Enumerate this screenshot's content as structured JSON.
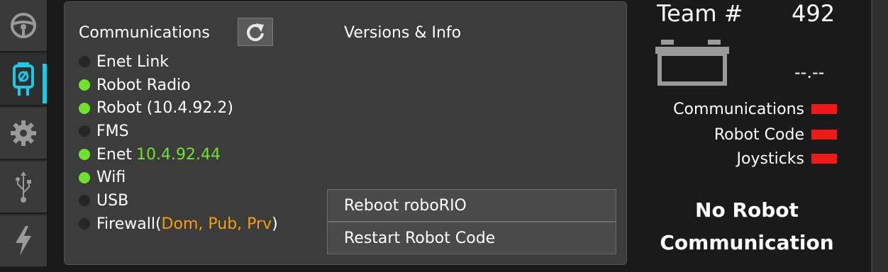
{
  "sidebar": {
    "tabs": [
      {
        "name": "steering-wheel-icon"
      },
      {
        "name": "plug-diagnostics-icon",
        "active": true
      },
      {
        "name": "gear-icon"
      },
      {
        "name": "usb-icon"
      },
      {
        "name": "lightning-icon"
      }
    ]
  },
  "communications": {
    "title": "Communications",
    "refresh_icon": "refresh-icon",
    "items": [
      {
        "label": "Enet Link",
        "status": "off"
      },
      {
        "label": "Robot Radio",
        "status": "on"
      },
      {
        "label": "Robot (10.4.92.2)",
        "status": "on"
      },
      {
        "label": "FMS",
        "status": "off"
      },
      {
        "label": "Enet",
        "value": "10.4.92.44",
        "status": "on"
      },
      {
        "label": "Wifi",
        "status": "on"
      },
      {
        "label": "USB",
        "status": "off"
      },
      {
        "label": "Firewall(",
        "fw_values": "Dom, Pub, Prv",
        "suffix": ")",
        "status": "off"
      }
    ]
  },
  "versions": {
    "title": "Versions & Info"
  },
  "actions": {
    "reboot_label": "Reboot roboRIO",
    "restart_label": "Restart Robot Code"
  },
  "status_panel": {
    "team_label": "Team #",
    "team_number": "492",
    "voltage": "--.--",
    "indicators": [
      {
        "label": "Communications",
        "color": "#ee1a1a"
      },
      {
        "label": "Robot Code",
        "color": "#ee1a1a"
      },
      {
        "label": "Joysticks",
        "color": "#ee1a1a"
      }
    ],
    "message_line1": "No Robot",
    "message_line2": "Communication"
  },
  "colors": {
    "on": "#6ee22c",
    "off": "#262626",
    "accent": "#1ec8e8",
    "warning": "#f0a010",
    "error": "#ee1a1a"
  }
}
